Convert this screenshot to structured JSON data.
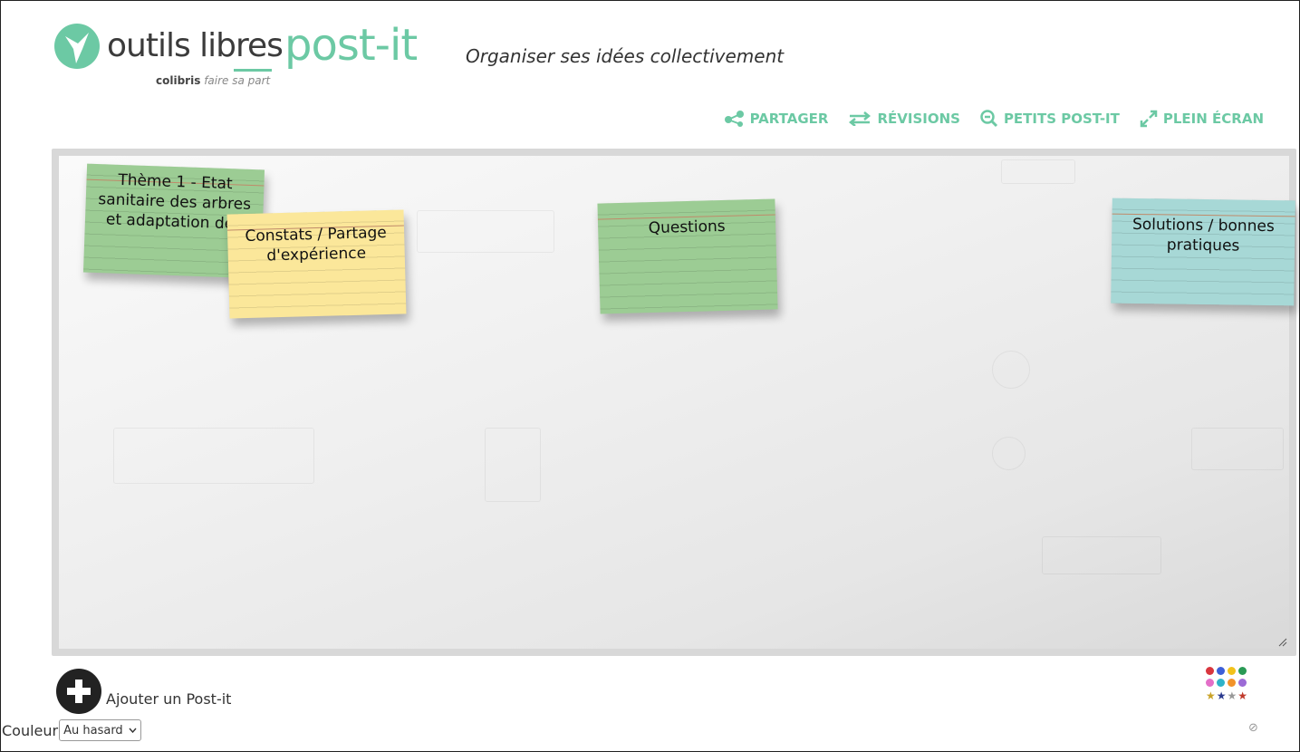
{
  "header": {
    "brand": {
      "part1": "outils ",
      "part2": "libres",
      "product": "post-it",
      "sub_bold": "colibris",
      "sub_italic": "faire sa part"
    },
    "tagline": "Organiser ses idées collectivement",
    "toolbar": [
      {
        "label": "PARTAGER",
        "icon": "share-icon"
      },
      {
        "label": "RÉVISIONS",
        "icon": "swap-arrows-icon"
      },
      {
        "label": "PETITS POST-IT",
        "icon": "zoom-out-icon"
      },
      {
        "label": "PLEIN ÉCRAN",
        "icon": "expand-icon"
      }
    ],
    "accent_color": "#6cc9a4"
  },
  "board": {
    "notes": [
      {
        "text": "Thème 1 - Etat sanitaire des arbres et adaptation des",
        "color": "green"
      },
      {
        "text": "Constats / Partage d'expérience",
        "color": "yellow"
      },
      {
        "text": "Questions",
        "color": "green"
      },
      {
        "text": "Solutions / bonnes pratiques",
        "color": "teal"
      }
    ]
  },
  "footer": {
    "add_label": "Ajouter un Post-it",
    "color_label": "Couleur",
    "color_select_value": "Au hasard",
    "palette_dots": [
      "#d9363e",
      "#3d5fd8",
      "#f2c21b",
      "#2a9a55",
      "#e36fc8",
      "#2fb3c9",
      "#f2932a",
      "#9c6bd6"
    ],
    "stars": [
      {
        "color": "#c9a227"
      },
      {
        "color": "#2b3a8f"
      },
      {
        "color": "#999999"
      },
      {
        "color": "#c0392b"
      }
    ]
  }
}
